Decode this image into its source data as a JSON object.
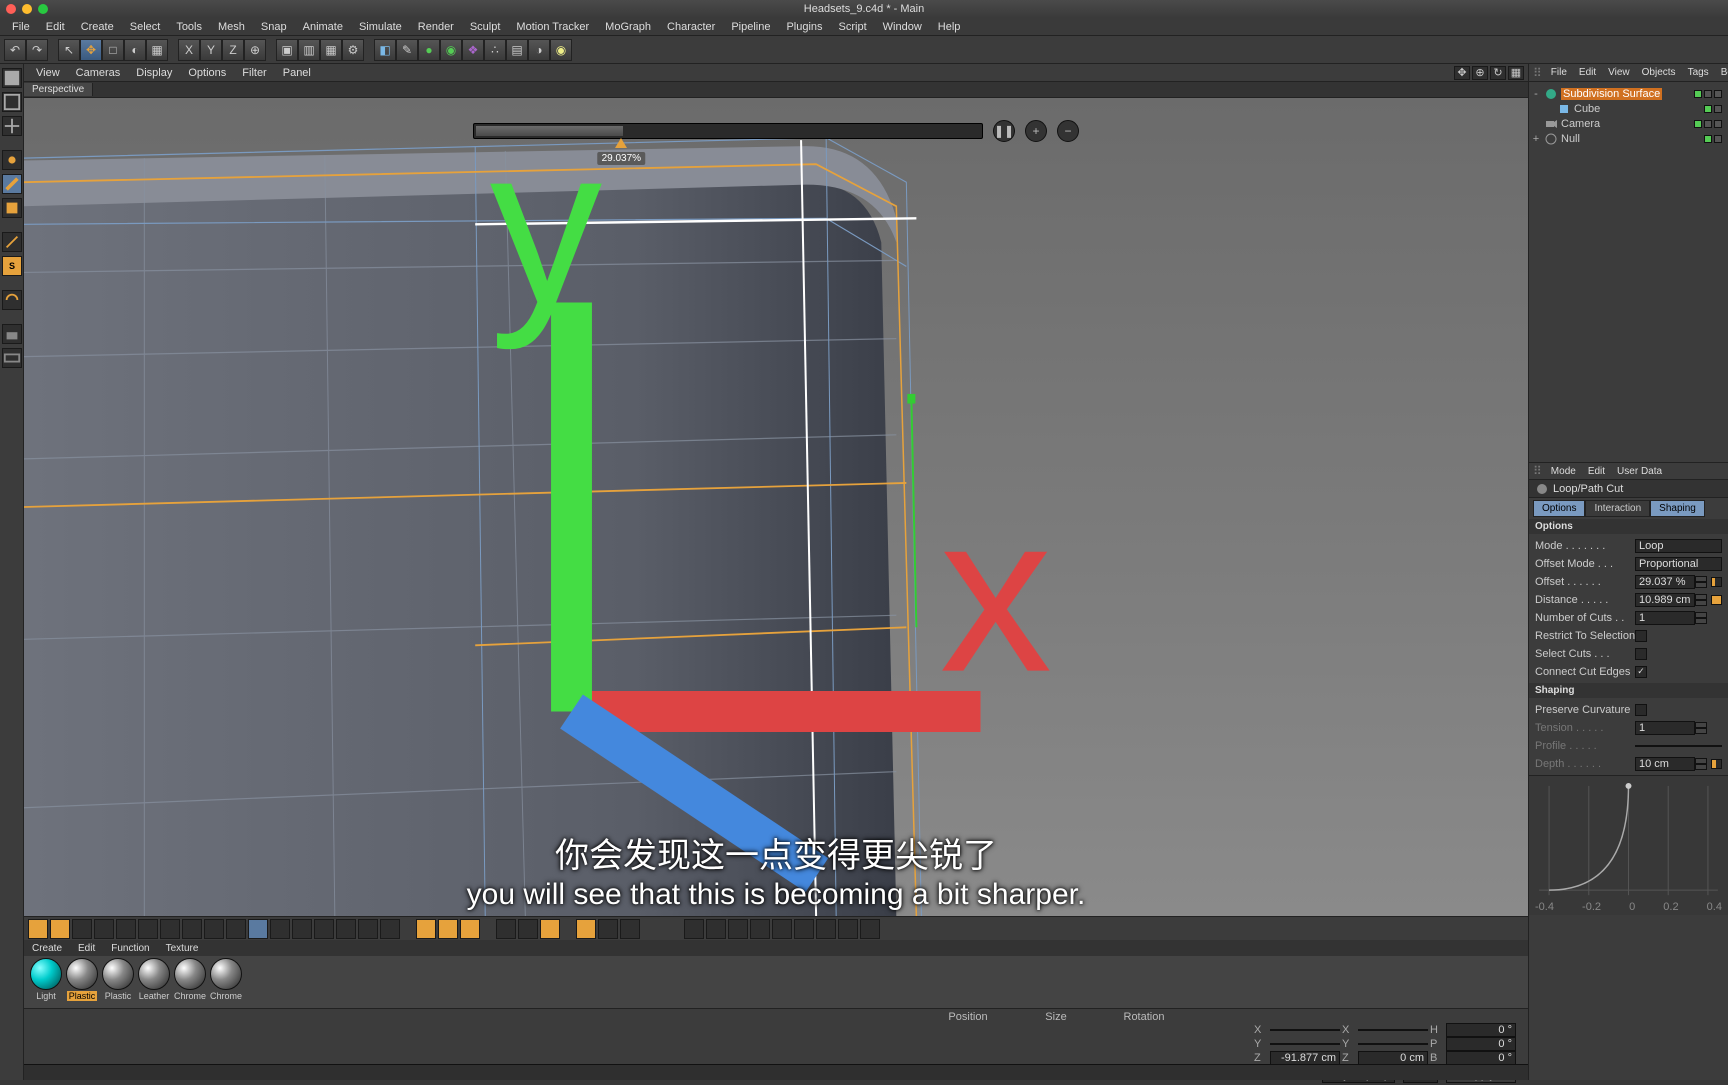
{
  "app": {
    "title": "Headsets_9.c4d * - Main"
  },
  "menubar": [
    "File",
    "Edit",
    "Create",
    "Select",
    "Tools",
    "Mesh",
    "Snap",
    "Animate",
    "Simulate",
    "Render",
    "Sculpt",
    "Motion Tracker",
    "MoGraph",
    "Character",
    "Pipeline",
    "Plugins",
    "Script",
    "Window",
    "Help"
  ],
  "view_menubar": [
    "View",
    "Cameras",
    "Display",
    "Options",
    "Filter",
    "Panel"
  ],
  "view_tab": "Perspective",
  "cut_overlay": {
    "percent_label": "29.037%"
  },
  "mat_menu": [
    "Create",
    "Edit",
    "Function",
    "Texture"
  ],
  "materials": [
    {
      "name": "Light",
      "cls": "light"
    },
    {
      "name": "Plastic",
      "sel": true
    },
    {
      "name": "Plastic"
    },
    {
      "name": "Leather"
    },
    {
      "name": "Chrome"
    },
    {
      "name": "Chrome"
    }
  ],
  "coords": {
    "headers": [
      "Position",
      "Size",
      "Rotation"
    ],
    "rows": [
      {
        "axis": "X",
        "pos": "",
        "size": "",
        "rot": "0 °"
      },
      {
        "axis": "Y",
        "pos": "",
        "size": "",
        "rot": "0 °"
      },
      {
        "axis": "Z",
        "pos": "-91.877 cm",
        "size": "0 cm",
        "rot": "0 °"
      }
    ],
    "dd1": "Object (Rel)",
    "dd2": "Size",
    "apply": "Apply"
  },
  "obj_menu": [
    "File",
    "Edit",
    "View",
    "Objects",
    "Tags",
    "Bookmar"
  ],
  "obj_tree": [
    {
      "indent": 0,
      "toggle": "-",
      "name": "Subdivision Surface",
      "sel": true,
      "kind": "subdiv"
    },
    {
      "indent": 1,
      "toggle": "",
      "name": "Cube",
      "kind": "cube"
    },
    {
      "indent": 0,
      "toggle": "",
      "name": "Camera",
      "kind": "camera"
    },
    {
      "indent": 0,
      "toggle": "+",
      "name": "Null",
      "kind": "null"
    }
  ],
  "attr_menu": [
    "Mode",
    "Edit",
    "User Data"
  ],
  "attr_title": "Loop/Path Cut",
  "attr_tabs": [
    "Options",
    "Interaction",
    "Shaping"
  ],
  "attr_active_tabs": [
    0,
    2
  ],
  "options": {
    "header": "Options",
    "rows": [
      {
        "label": "Mode",
        "type": "dd",
        "value": "Loop"
      },
      {
        "label": "Offset Mode",
        "type": "dd",
        "value": "Proportional"
      },
      {
        "label": "Offset",
        "type": "num",
        "value": "29.037 %",
        "slider": 29
      },
      {
        "label": "Distance",
        "type": "num",
        "value": "10.989 cm",
        "slider": 98,
        "slidercolor": "#e6a23c"
      },
      {
        "label": "Number of Cuts",
        "type": "num",
        "value": "1"
      },
      {
        "label": "Restrict To Selection",
        "type": "chk",
        "on": false
      },
      {
        "label": "Select Cuts",
        "type": "chk",
        "on": false
      },
      {
        "label": "Connect Cut Edges",
        "type": "chk",
        "on": true
      }
    ]
  },
  "shaping": {
    "header": "Shaping",
    "rows": [
      {
        "label": "Preserve Curvature",
        "type": "chk",
        "on": false
      },
      {
        "label": "Tension",
        "type": "num",
        "value": "1",
        "dim": true
      },
      {
        "label": "Profile",
        "type": "dd",
        "value": "",
        "dim": true
      },
      {
        "label": "Depth",
        "type": "num",
        "value": "10 cm",
        "dim": true,
        "slider": 40
      }
    ],
    "curve_labels": [
      "-0.4",
      "-0.2",
      "0",
      "0.2",
      "0.4"
    ]
  },
  "subs": {
    "cn": "你会发现这一点变得更尖锐了",
    "en": "you will see that this is becoming a bit sharper."
  }
}
